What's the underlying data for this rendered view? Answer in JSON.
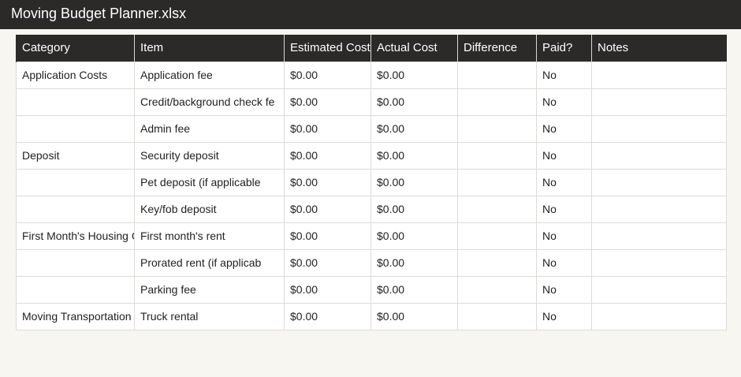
{
  "window": {
    "title": "Moving Budget Planner.xlsx"
  },
  "table": {
    "columns": [
      "Category",
      "Item",
      "Estimated Cost",
      "Actual Cost",
      "Difference",
      "Paid?",
      "Notes"
    ],
    "rows": [
      {
        "category": "Application Costs",
        "item": "Application fee",
        "estimated": "$0.00",
        "actual": "$0.00",
        "difference": "",
        "paid": "No",
        "notes": ""
      },
      {
        "category": "",
        "item": "Credit/background check fe",
        "estimated": "$0.00",
        "actual": "$0.00",
        "difference": "",
        "paid": "No",
        "notes": ""
      },
      {
        "category": "",
        "item": "Admin fee",
        "estimated": "$0.00",
        "actual": "$0.00",
        "difference": "",
        "paid": "No",
        "notes": ""
      },
      {
        "category": "Deposit",
        "item": "Security deposit",
        "estimated": "$0.00",
        "actual": "$0.00",
        "difference": "",
        "paid": "No",
        "notes": ""
      },
      {
        "category": "",
        "item": "Pet deposit (if applicable",
        "estimated": "$0.00",
        "actual": "$0.00",
        "difference": "",
        "paid": "No",
        "notes": ""
      },
      {
        "category": "",
        "item": "Key/fob deposit",
        "estimated": "$0.00",
        "actual": "$0.00",
        "difference": "",
        "paid": "No",
        "notes": ""
      },
      {
        "category": "First Month's Housing Co",
        "item": "First month's rent",
        "estimated": "$0.00",
        "actual": "$0.00",
        "difference": "",
        "paid": "No",
        "notes": ""
      },
      {
        "category": "",
        "item": "Prorated rent (if applicab",
        "estimated": "$0.00",
        "actual": "$0.00",
        "difference": "",
        "paid": "No",
        "notes": ""
      },
      {
        "category": "",
        "item": "Parking fee",
        "estimated": "$0.00",
        "actual": "$0.00",
        "difference": "",
        "paid": "No",
        "notes": ""
      },
      {
        "category": "Moving Transportation",
        "item": "Truck rental",
        "estimated": "$0.00",
        "actual": "$0.00",
        "difference": "",
        "paid": "No",
        "notes": ""
      }
    ]
  }
}
